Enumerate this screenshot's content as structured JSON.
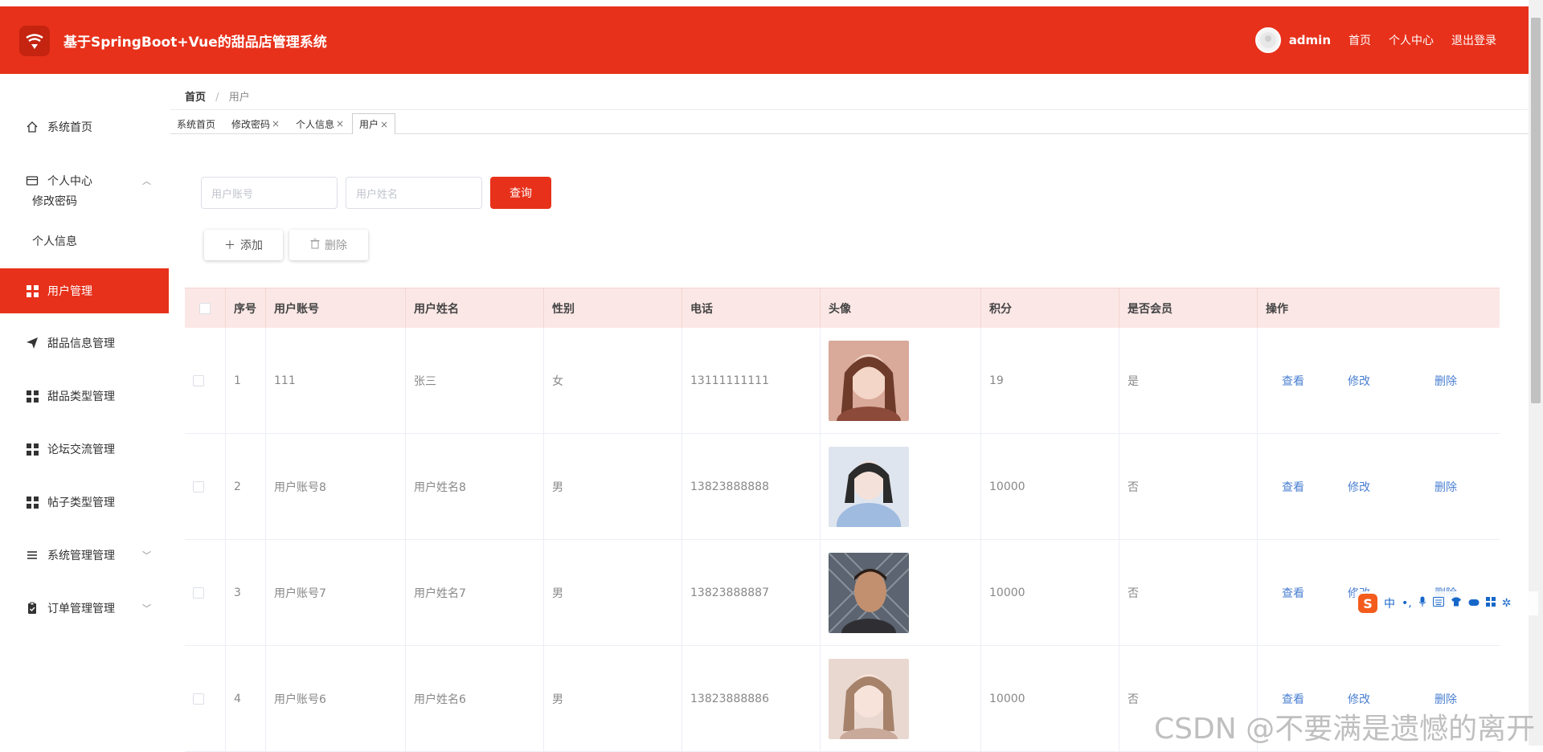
{
  "app": {
    "title": "基于SpringBoot+Vue的甜品店管理系统",
    "accent": "#e7311b",
    "brand_color": "#e7311b"
  },
  "header": {
    "username": "admin",
    "home": "首页",
    "profile": "个人中心",
    "logout": "退出登录"
  },
  "sidebar": {
    "items": [
      {
        "label": "系统首页",
        "icon": "home-icon"
      },
      {
        "label": "个人中心",
        "icon": "card-icon",
        "expanded": true,
        "children": [
          "修改密码",
          "个人信息"
        ]
      },
      {
        "label": "用户管理",
        "icon": "grid-icon",
        "active": true
      },
      {
        "label": "甜品信息管理",
        "icon": "send-icon"
      },
      {
        "label": "甜品类型管理",
        "icon": "grid-icon"
      },
      {
        "label": "论坛交流管理",
        "icon": "grid-icon"
      },
      {
        "label": "帖子类型管理",
        "icon": "grid-icon"
      },
      {
        "label": "系统管理管理",
        "icon": "list-icon"
      },
      {
        "label": "订单管理管理",
        "icon": "clipboard-icon"
      }
    ]
  },
  "breadcrumb": {
    "home": "首页",
    "separator": "/",
    "current": "用户"
  },
  "tabs": [
    {
      "label": "系统首页",
      "closable": false
    },
    {
      "label": "修改密码",
      "closable": true
    },
    {
      "label": "个人信息",
      "closable": true
    },
    {
      "label": "用户",
      "closable": true,
      "active": true
    }
  ],
  "tab_close": "×",
  "search": {
    "account_placeholder": "用户账号",
    "name_placeholder": "用户姓名",
    "query_label": "查询"
  },
  "toolbar": {
    "add_label": "添加",
    "delete_label": "删除"
  },
  "table": {
    "headers": [
      "序号",
      "用户账号",
      "用户姓名",
      "性别",
      "电话",
      "头像",
      "积分",
      "是否会员",
      "操作"
    ],
    "actions": {
      "view": "查看",
      "edit": "修改",
      "delete": "删除"
    },
    "rows": [
      {
        "index": "1",
        "account": "111",
        "name": "张三",
        "gender": "女",
        "phone": "13111111111",
        "points": "19",
        "member": "是"
      },
      {
        "index": "2",
        "account": "用户账号8",
        "name": "用户姓名8",
        "gender": "男",
        "phone": "13823888888",
        "points": "10000",
        "member": "否"
      },
      {
        "index": "3",
        "account": "用户账号7",
        "name": "用户姓名7",
        "gender": "男",
        "phone": "13823888887",
        "points": "10000",
        "member": "否"
      },
      {
        "index": "4",
        "account": "用户账号6",
        "name": "用户姓名6",
        "gender": "男",
        "phone": "13823888886",
        "points": "10000",
        "member": "否"
      }
    ]
  },
  "ime": {
    "logo": "S",
    "mode": "中"
  },
  "watermark": "CSDN @不要满是遗憾的离开"
}
